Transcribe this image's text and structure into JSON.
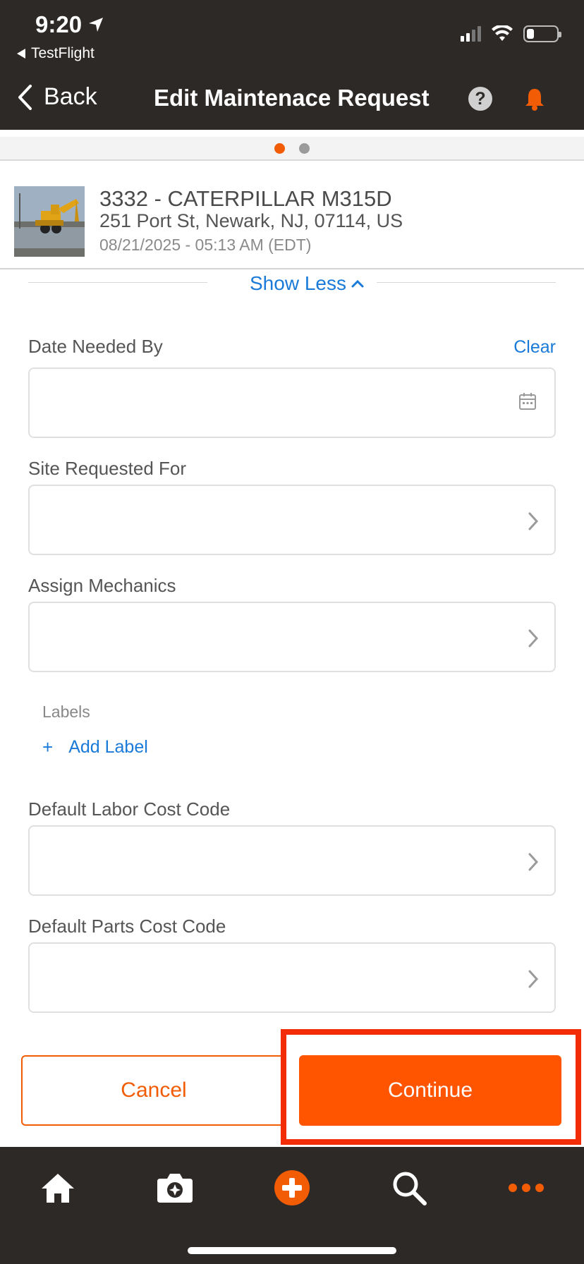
{
  "status_bar": {
    "time": "9:20",
    "back_app": "TestFlight"
  },
  "nav": {
    "back_label": "Back",
    "title": "Edit Maintenace Request"
  },
  "asset": {
    "title": "3332 - CATERPILLAR M315D",
    "address": "251 Port St, Newark, NJ, 07114, US",
    "datetime": "08/21/2025 - 05:13 AM (EDT)"
  },
  "show_less": "Show Less",
  "form": {
    "date_needed": {
      "label": "Date Needed By",
      "clear": "Clear",
      "value": ""
    },
    "site_requested": {
      "label": "Site Requested For",
      "value": ""
    },
    "assign_mechanics": {
      "label": "Assign Mechanics",
      "value": ""
    },
    "labels": {
      "caption": "Labels",
      "add": "Add Label",
      "plus": "+"
    },
    "labor_cost_code": {
      "label": "Default Labor Cost Code",
      "value": ""
    },
    "parts_cost_code": {
      "label": "Default Parts Cost Code",
      "value": ""
    }
  },
  "actions": {
    "cancel": "Cancel",
    "continue": "Continue"
  },
  "colors": {
    "accent": "#f25c05",
    "link": "#1a7ad8",
    "header_bg": "#2d2926"
  },
  "tabs": [
    "home-icon",
    "camera-icon",
    "add-icon",
    "search-icon",
    "more-icon"
  ]
}
